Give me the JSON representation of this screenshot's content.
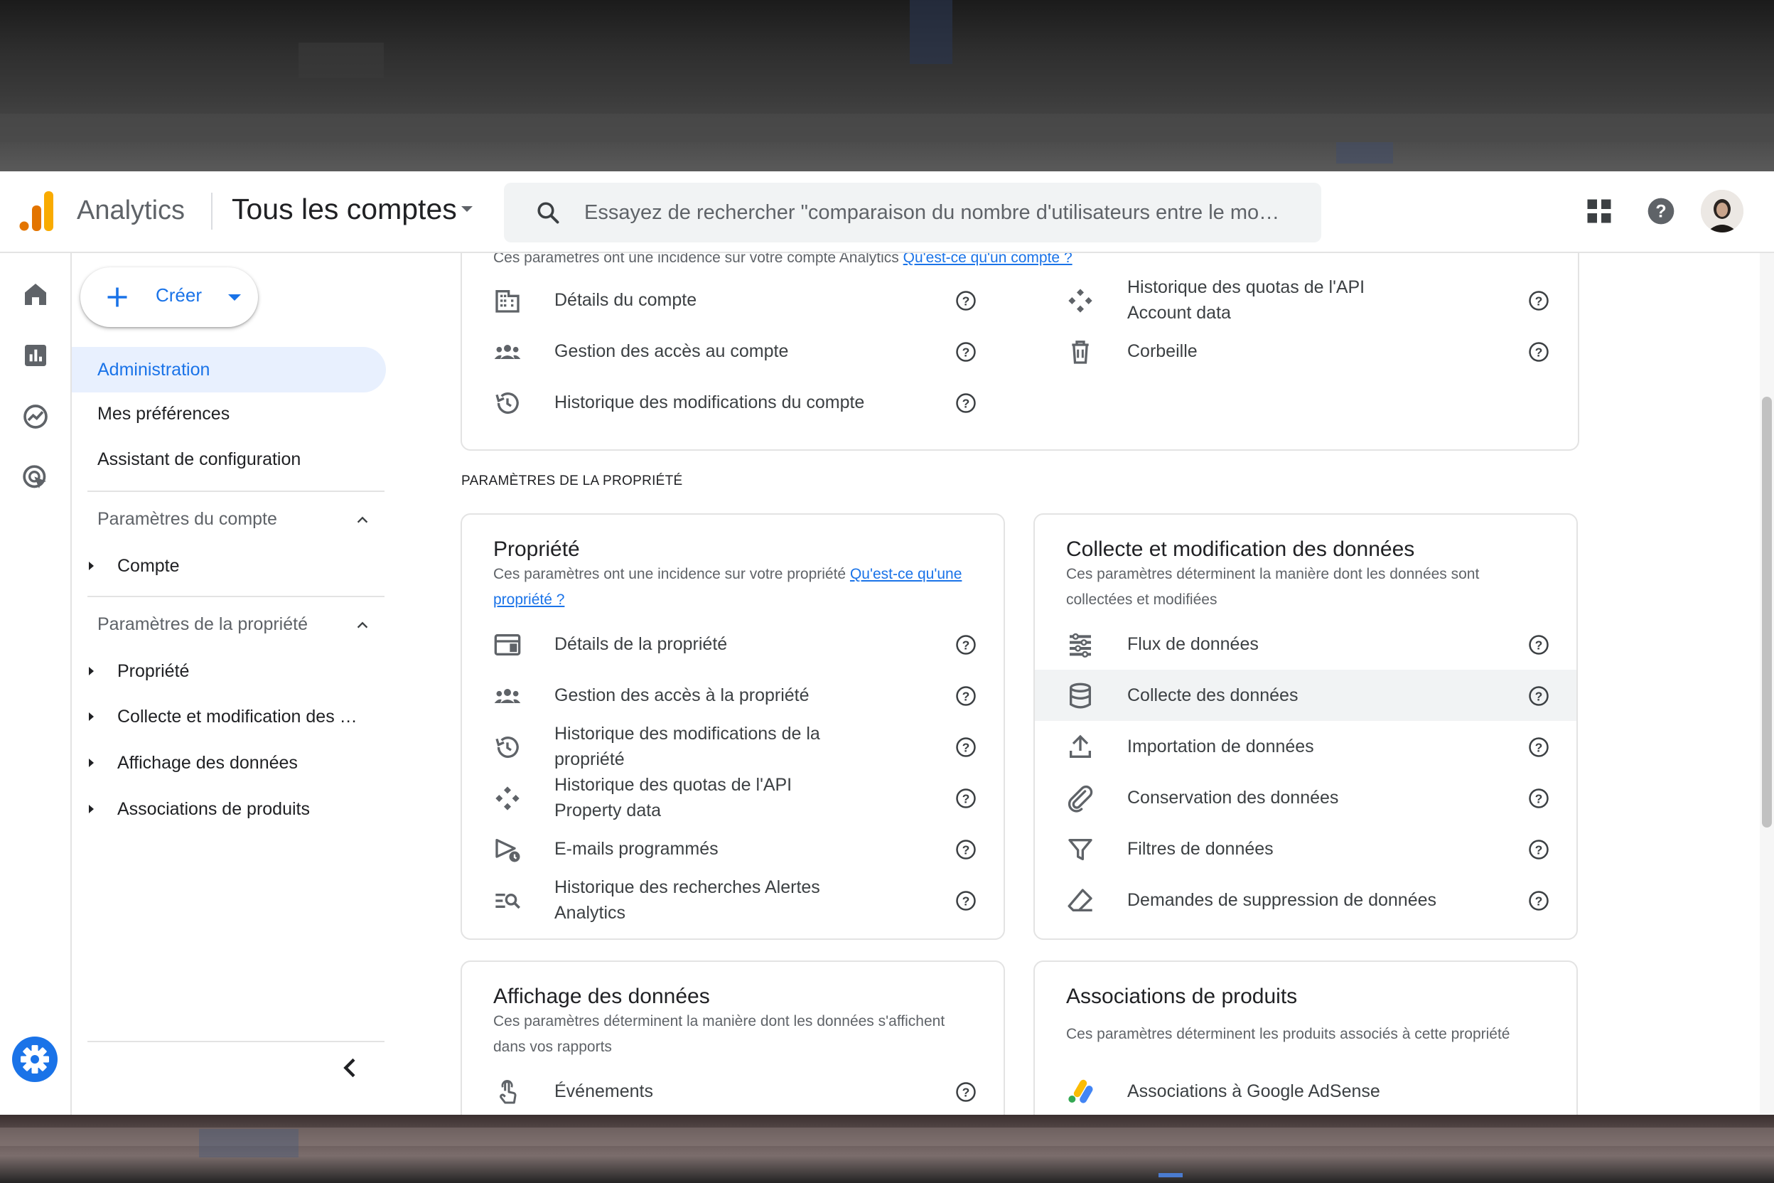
{
  "app": {
    "name": "Analytics",
    "account_picker": "Tous les comptes",
    "search_placeholder": "Essayez de rechercher \"comparaison du nombre d'utilisateurs entre le mo…"
  },
  "colors": {
    "accent": "#1a73e8",
    "logo_orange": "#f9ab00",
    "logo_dark_orange": "#e37400"
  },
  "rail": {
    "icons": [
      "home-icon",
      "reports-icon",
      "explore-icon",
      "advertising-icon",
      "settings-icon"
    ]
  },
  "nav": {
    "create_label": "Créer",
    "admin": "Administration",
    "prefs": "Mes préférences",
    "assistant": "Assistant de configuration",
    "account_section": "Paramètres du compte",
    "account_items": [
      "Compte"
    ],
    "property_section": "Paramètres de la propriété",
    "property_items": [
      "Propriété",
      "Collecte et modification des …",
      "Affichage des données",
      "Associations de produits"
    ]
  },
  "account_card": {
    "cut_desc": "Ces paramètres ont une incidence sur votre compte Analytics",
    "cut_link": "Qu'est-ce qu'un compte ?",
    "left_rows": [
      {
        "label": "Détails du compte",
        "icon": "building-icon"
      },
      {
        "label": "Gestion des accès au compte",
        "icon": "people-icon"
      },
      {
        "label": "Historique des modifications du compte",
        "icon": "history-icon"
      }
    ],
    "right_rows": [
      {
        "label": "Historique des quotas de l'API Account data",
        "icon": "api-icon"
      },
      {
        "label": "Corbeille",
        "icon": "trash-icon"
      }
    ]
  },
  "property_section_label": "PARAMÈTRES DE LA PROPRIÉTÉ",
  "property_card": {
    "title": "Propriété",
    "desc": "Ces paramètres ont une incidence sur votre propriété ",
    "link": "Qu'est-ce qu'une propriété ?",
    "rows": [
      {
        "label": "Détails de la propriété",
        "icon": "property-details-icon"
      },
      {
        "label": "Gestion des accès à la propriété",
        "icon": "people-icon"
      },
      {
        "label": "Historique des modifications de la propriété",
        "icon": "history-icon"
      },
      {
        "label": "Historique des quotas de l'API Property data",
        "icon": "api-icon"
      },
      {
        "label": "E-mails programmés",
        "icon": "scheduled-email-icon"
      },
      {
        "label": "Historique des recherches Alertes Analytics",
        "icon": "search-history-icon"
      }
    ]
  },
  "data_card": {
    "title": "Collecte et modification des données",
    "desc": "Ces paramètres déterminent la manière dont les données sont collectées et modifiées",
    "rows": [
      {
        "label": "Flux de données",
        "icon": "data-streams-icon"
      },
      {
        "label": "Collecte des données",
        "icon": "database-icon"
      },
      {
        "label": "Importation de données",
        "icon": "upload-icon"
      },
      {
        "label": "Conservation des données",
        "icon": "retention-icon"
      },
      {
        "label": "Filtres de données",
        "icon": "filter-icon"
      },
      {
        "label": "Demandes de suppression de données",
        "icon": "eraser-icon"
      }
    ]
  },
  "display_card": {
    "title": "Affichage des données",
    "desc": "Ces paramètres déterminent la manière dont les données s'affichent dans vos rapports",
    "rows": [
      {
        "label": "Événements",
        "icon": "touch-icon"
      }
    ]
  },
  "links_card": {
    "title": "Associations de produits",
    "desc": "Ces paramètres déterminent les produits associés à cette propriété",
    "rows": [
      {
        "label": "Associations à Google AdSense",
        "icon": "adsense-icon"
      }
    ]
  }
}
